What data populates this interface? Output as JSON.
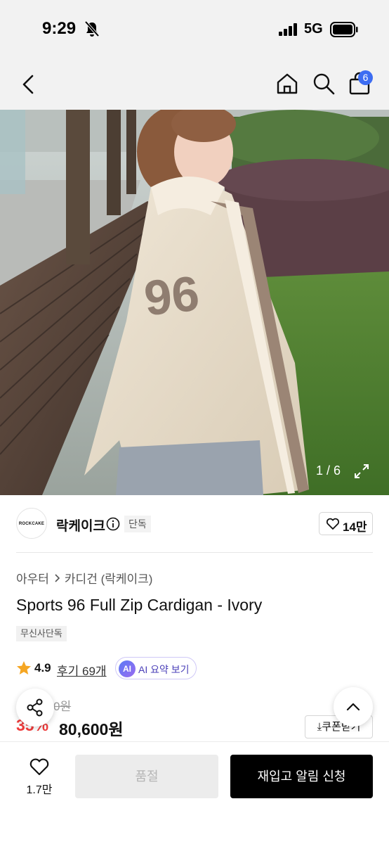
{
  "status_bar": {
    "time": "9:29",
    "network": "5G"
  },
  "nav": {
    "cart_count": "6"
  },
  "hero": {
    "page_indicator": "1 / 6"
  },
  "brand": {
    "logo_text": "ROCKCAKE",
    "name": "락케이크",
    "tag": "단독",
    "like_count": "14만"
  },
  "breadcrumb": {
    "category": "아우터",
    "subcategory": "카디건 (락케이크)"
  },
  "product": {
    "title": "Sports 96 Full Zip Cardigan - Ivory",
    "exclusive_badge": "무신사단독",
    "rating": "4.9",
    "review_link": "후기 69개",
    "ai_badge": "AI",
    "ai_summary_label": "AI 요약 보기",
    "original_price_visible": "0원",
    "discount_rate": "35%",
    "sale_price": "80,600원",
    "coupon_label": "쿠폰받기"
  },
  "bottom_bar": {
    "wish_count": "1.7만",
    "soldout_label": "품절",
    "restock_label": "재입고 알림 신청"
  },
  "colors": {
    "accent_blue": "#3d6df2",
    "discount_red": "#f03c3c",
    "cta_black": "#000000"
  }
}
